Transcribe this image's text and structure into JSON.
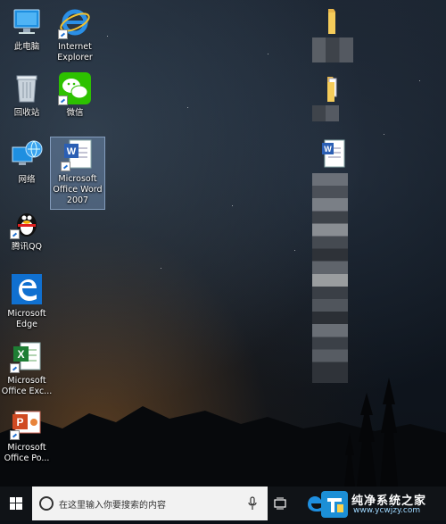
{
  "desktop": {
    "left_icons": [
      {
        "name": "this-pc",
        "label": "此电脑"
      },
      {
        "name": "internet-explorer",
        "label": "Internet Explorer"
      },
      {
        "name": "recycle-bin",
        "label": "回收站"
      },
      {
        "name": "wechat",
        "label": "微信"
      },
      {
        "name": "network",
        "label": "网络"
      },
      {
        "name": "word-2007",
        "label": "Microsoft Office Word 2007"
      },
      {
        "name": "tencent-qq",
        "label": "腾讯QQ"
      },
      {
        "name": "edge",
        "label": "Microsoft Edge"
      },
      {
        "name": "excel",
        "label": "Microsoft Office Exc..."
      },
      {
        "name": "powerpoint",
        "label": "Microsoft Office Po..."
      }
    ]
  },
  "taskbar": {
    "search_placeholder": "在这里输入你要搜索的内容"
  },
  "watermark": {
    "title": "纯净系统之家",
    "url": "www.ycwjzy.com"
  }
}
